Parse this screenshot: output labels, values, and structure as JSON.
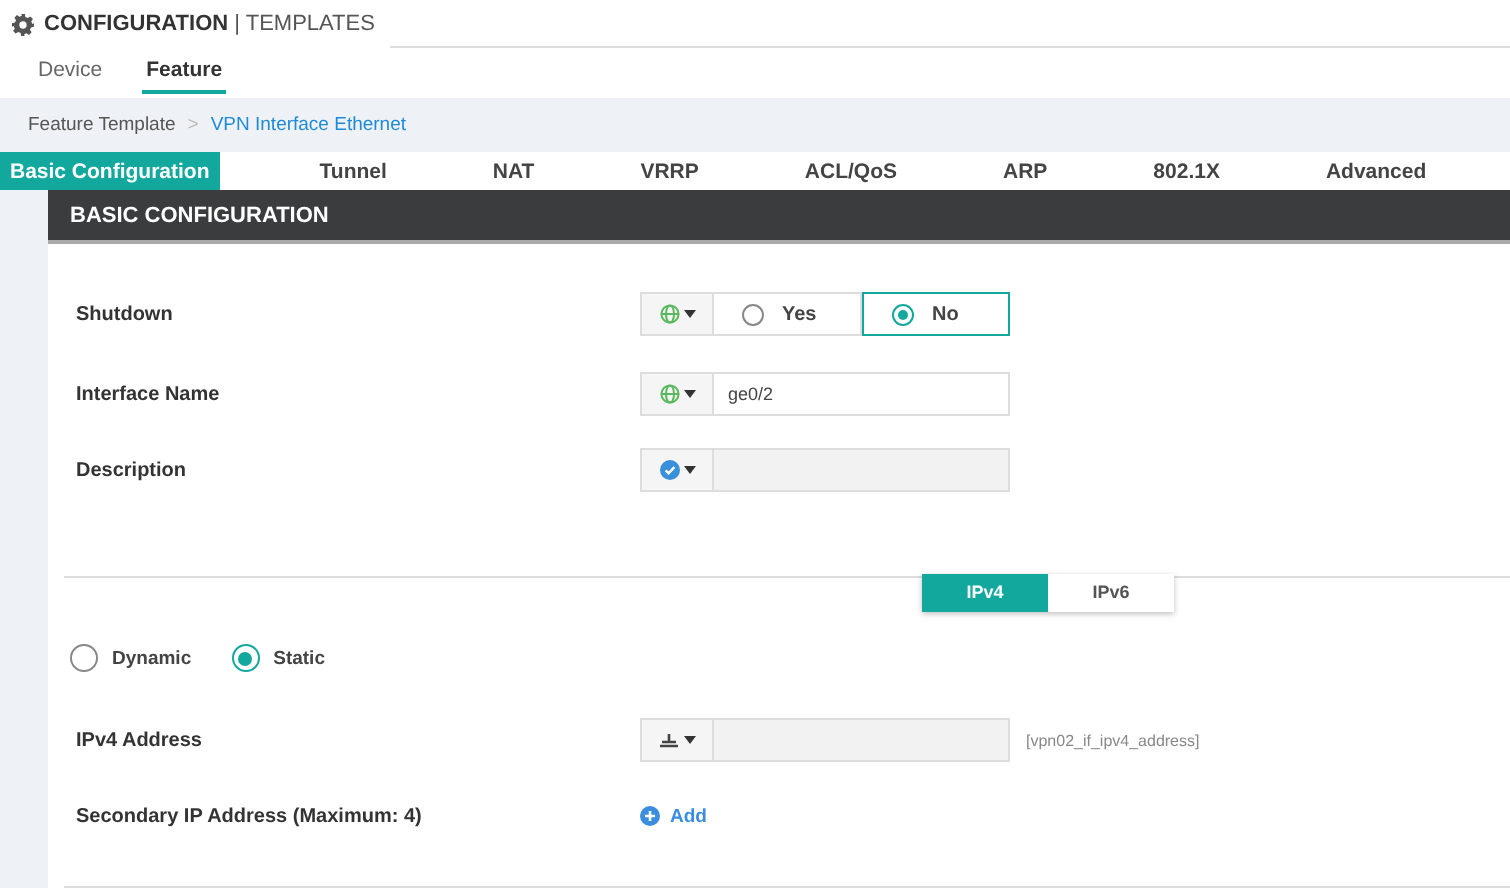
{
  "header": {
    "title": "CONFIGURATION",
    "separator": "|",
    "subtitle": "TEMPLATES"
  },
  "tabs": [
    {
      "label": "Device",
      "selected": false
    },
    {
      "label": "Feature",
      "selected": true
    }
  ],
  "breadcrumb": {
    "parent": "Feature Template",
    "separator": ">",
    "current": "VPN Interface Ethernet"
  },
  "section_tabs": [
    {
      "label": "Basic Configuration",
      "selected": true
    },
    {
      "label": "Tunnel",
      "selected": false
    },
    {
      "label": "NAT",
      "selected": false
    },
    {
      "label": "VRRP",
      "selected": false
    },
    {
      "label": "ACL/QoS",
      "selected": false
    },
    {
      "label": "ARP",
      "selected": false
    },
    {
      "label": "802.1X",
      "selected": false
    },
    {
      "label": "Advanced",
      "selected": false
    }
  ],
  "section_title": "BASIC CONFIGURATION",
  "fields": [
    {
      "label": "Shutdown",
      "kind": "radio",
      "scope": {
        "kind": "global"
      },
      "options": [
        {
          "label": "Yes",
          "selected": false
        },
        {
          "label": "No",
          "selected": true
        }
      ]
    },
    {
      "label": "Interface Name",
      "kind": "text",
      "scope": {
        "kind": "global"
      },
      "disabled": false,
      "value": "ge0/2"
    },
    {
      "label": "Description",
      "kind": "text",
      "scope": {
        "kind": "default"
      },
      "disabled": true
    }
  ],
  "ip_tabs": [
    {
      "label": "IPv4",
      "selected": true
    },
    {
      "label": "IPv6",
      "selected": false
    }
  ],
  "address_mode": [
    {
      "label": "Dynamic",
      "selected": false
    },
    {
      "label": "Static",
      "selected": true
    }
  ],
  "ip_fields": [
    {
      "label": "IPv4 Address",
      "kind": "text",
      "scope": {
        "kind": "device"
      },
      "disabled": true,
      "variable": "[vpn02_if_ipv4_address]"
    },
    {
      "label": "Secondary IP Address (Maximum: 4)",
      "kind": "add",
      "action": "Add"
    }
  ]
}
